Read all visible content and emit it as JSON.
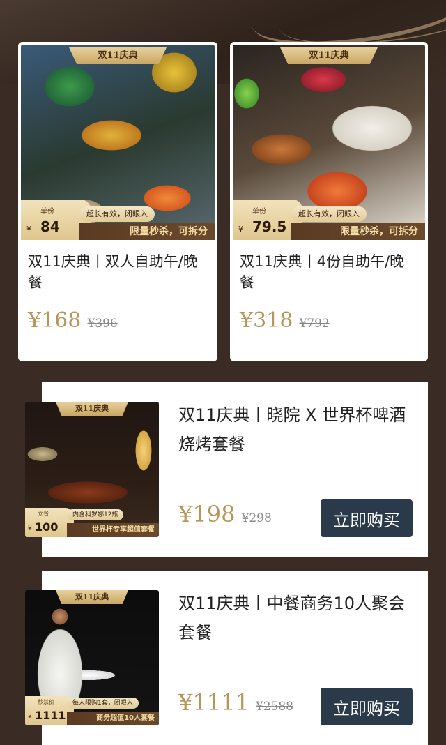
{
  "colors": {
    "background": "#3a2c24",
    "gold_price": "#b89558",
    "button_bg": "#2b3a4a",
    "badge_strip_text": "#f3dca4"
  },
  "cards": [
    {
      "ribbon": "双11庆典",
      "price_label": "单份",
      "currency": "¥",
      "unit_price": "84",
      "pill": "超长有效，闭眼入",
      "strip": "限量秒杀，可拆分",
      "title": "双11庆典丨双人自助午/晚餐",
      "price_now": "¥168",
      "price_old": "¥396"
    },
    {
      "ribbon": "双11庆典",
      "price_label": "单份",
      "currency": "¥",
      "unit_price": "79.5",
      "pill": "超长有效，闭眼入",
      "strip": "限量秒杀，可拆分",
      "title": "双11庆典丨4份自助午/晚餐",
      "price_now": "¥318",
      "price_old": "¥792"
    }
  ],
  "wide_cards": [
    {
      "ribbon": "双11庆典",
      "price_label": "立省",
      "currency": "¥",
      "unit_price": "100",
      "pill": "内含科罗娜12瓶",
      "strip": "世界杯专享超值套餐",
      "title": "双11庆典丨晓院 X 世界杯啤酒烧烤套餐",
      "price_now": "¥198",
      "price_old": "¥298",
      "button": "立即购买"
    },
    {
      "ribbon": "双11庆典",
      "price_label": "秒杀价",
      "currency": "¥",
      "unit_price": "1111",
      "pill": "每人限购1套，闭眼入",
      "strip": "商务超值10人套餐",
      "title": "双11庆典丨中餐商务10人聚会套餐",
      "price_now": "¥1111",
      "price_old": "¥2588",
      "button": "立即购买"
    }
  ]
}
